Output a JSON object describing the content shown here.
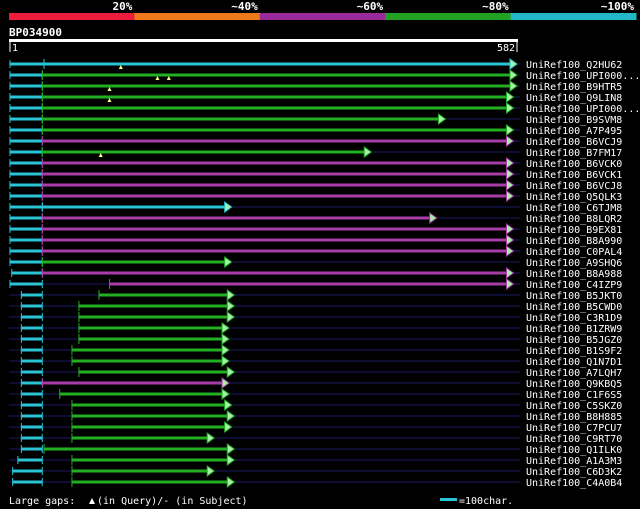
{
  "identity_scale": {
    "ticks": [
      "20%",
      "~40%",
      "~60%",
      "~80%",
      "~100%"
    ],
    "colors": [
      "#ee1c3c",
      "#ee7a1c",
      "#9a2a9a",
      "#22a022",
      "#22b8c8"
    ]
  },
  "query": {
    "id": "BP034900",
    "start_label": "1",
    "end_label": "582",
    "length": 582
  },
  "footer": {
    "gaps_prefix": "Large gaps: ",
    "gaps_query": "(in Query)/",
    "gaps_dash": "-",
    "gaps_subject": " (in Subject)",
    "scale_label": "=100char."
  },
  "colors": {
    "query_segment": "#29c5d6",
    "green": "#22b022",
    "purple": "#a83ca8",
    "arrow_fill": "#a8f0a8",
    "guide": "#1a1a66",
    "gap_marker": "#ffff88"
  },
  "chart_data": {
    "type": "alignment-overview",
    "query_length": 582,
    "hits": [
      {
        "name": "UniRef100_Q2HU62",
        "color": "cyan",
        "qs": 1,
        "qe": 40,
        "ss": 40,
        "se": 582,
        "gaps": []
      },
      {
        "name": "UniRef100_UPI000...",
        "color": "green",
        "qs": 1,
        "qe": 38,
        "ss": 38,
        "se": 582,
        "gaps": [
          128
        ]
      },
      {
        "name": "UniRef100_B9HTR5",
        "color": "green",
        "qs": 1,
        "qe": 38,
        "ss": 38,
        "se": 582,
        "gaps": [
          170,
          183
        ]
      },
      {
        "name": "UniRef100_Q9LIN8",
        "color": "green",
        "qs": 1,
        "qe": 38,
        "ss": 38,
        "se": 578,
        "gaps": [
          115
        ]
      },
      {
        "name": "UniRef100_UPI000...",
        "color": "green",
        "qs": 1,
        "qe": 38,
        "ss": 38,
        "se": 578,
        "gaps": [
          115
        ]
      },
      {
        "name": "UniRef100_B9SVM8",
        "color": "green",
        "qs": 1,
        "qe": 38,
        "ss": 38,
        "se": 500,
        "gaps": []
      },
      {
        "name": "UniRef100_A7P495",
        "color": "green",
        "qs": 1,
        "qe": 38,
        "ss": 38,
        "se": 578,
        "gaps": []
      },
      {
        "name": "UniRef100_B6VCJ9",
        "color": "purple",
        "qs": 1,
        "qe": 38,
        "ss": 38,
        "se": 578,
        "gaps": []
      },
      {
        "name": "UniRef100_B7FM17",
        "color": "green",
        "qs": 1,
        "qe": 38,
        "ss": 38,
        "se": 415,
        "gaps": []
      },
      {
        "name": "UniRef100_B6VCK0",
        "color": "purple",
        "qs": 1,
        "qe": 38,
        "ss": 38,
        "se": 578,
        "gaps": [
          105
        ]
      },
      {
        "name": "UniRef100_B6VCK1",
        "color": "purple",
        "qs": 1,
        "qe": 38,
        "ss": 38,
        "se": 578,
        "gaps": []
      },
      {
        "name": "UniRef100_B6VCJ8",
        "color": "purple",
        "qs": 1,
        "qe": 38,
        "ss": 38,
        "se": 578,
        "gaps": []
      },
      {
        "name": "UniRef100_Q5QLK3",
        "color": "purple",
        "qs": 1,
        "qe": 38,
        "ss": 38,
        "se": 578,
        "gaps": []
      },
      {
        "name": "UniRef100_C6TJM8",
        "color": "cyan",
        "qs": 1,
        "qe": 38,
        "ss": 38,
        "se": 255,
        "gaps": []
      },
      {
        "name": "UniRef100_B8LQR2",
        "color": "purple",
        "qs": 1,
        "qe": 38,
        "ss": 38,
        "se": 490,
        "gaps": []
      },
      {
        "name": "UniRef100_B9EX81",
        "color": "purple",
        "qs": 1,
        "qe": 38,
        "ss": 38,
        "se": 578,
        "gaps": []
      },
      {
        "name": "UniRef100_B8A990",
        "color": "purple",
        "qs": 1,
        "qe": 38,
        "ss": 38,
        "se": 578,
        "gaps": []
      },
      {
        "name": "UniRef100_C0PAL4",
        "color": "purple",
        "qs": 1,
        "qe": 38,
        "ss": 38,
        "se": 578,
        "gaps": []
      },
      {
        "name": "UniRef100_A9SHQ6",
        "color": "green",
        "qs": 1,
        "qe": 38,
        "ss": 38,
        "se": 255,
        "gaps": []
      },
      {
        "name": "UniRef100_B8A988",
        "color": "purple",
        "qs": 3,
        "qe": 38,
        "ss": 38,
        "se": 578,
        "gaps": []
      },
      {
        "name": "UniRef100_C4IZP9",
        "color": "purple",
        "qs": 1,
        "qe": 38,
        "ss": 115,
        "se": 578,
        "gaps": []
      },
      {
        "name": "UniRef100_B5JKT0",
        "color": "green",
        "qs": 14,
        "qe": 38,
        "ss": 103,
        "se": 258,
        "gaps": []
      },
      {
        "name": "UniRef100_B5CWD0",
        "color": "green",
        "qs": 14,
        "qe": 38,
        "ss": 80,
        "se": 258,
        "gaps": []
      },
      {
        "name": "UniRef100_C3R1D9",
        "color": "green",
        "qs": 14,
        "qe": 38,
        "ss": 80,
        "se": 258,
        "gaps": []
      },
      {
        "name": "UniRef100_B1ZRW9",
        "color": "green",
        "qs": 14,
        "qe": 38,
        "ss": 80,
        "se": 252,
        "gaps": []
      },
      {
        "name": "UniRef100_B5JGZ0",
        "color": "green",
        "qs": 14,
        "qe": 38,
        "ss": 80,
        "se": 252,
        "gaps": []
      },
      {
        "name": "UniRef100_B1S9F2",
        "color": "green",
        "qs": 14,
        "qe": 38,
        "ss": 72,
        "se": 252,
        "gaps": []
      },
      {
        "name": "UniRef100_Q1N7D1",
        "color": "green",
        "qs": 14,
        "qe": 38,
        "ss": 72,
        "se": 252,
        "gaps": []
      },
      {
        "name": "UniRef100_A7LQH7",
        "color": "green",
        "qs": 14,
        "qe": 38,
        "ss": 80,
        "se": 258,
        "gaps": []
      },
      {
        "name": "UniRef100_Q9KBQ5",
        "color": "purple",
        "qs": 14,
        "qe": 38,
        "ss": 38,
        "se": 252,
        "gaps": []
      },
      {
        "name": "UniRef100_C1F6S5",
        "color": "green",
        "qs": 14,
        "qe": 38,
        "ss": 58,
        "se": 252,
        "gaps": []
      },
      {
        "name": "UniRef100_C5SKZ0",
        "color": "green",
        "qs": 14,
        "qe": 38,
        "ss": 72,
        "se": 255,
        "gaps": []
      },
      {
        "name": "UniRef100_B8H885",
        "color": "green",
        "qs": 14,
        "qe": 38,
        "ss": 72,
        "se": 258,
        "gaps": []
      },
      {
        "name": "UniRef100_C7PCU7",
        "color": "green",
        "qs": 14,
        "qe": 38,
        "ss": 72,
        "se": 255,
        "gaps": []
      },
      {
        "name": "UniRef100_C9RT70",
        "color": "green",
        "qs": 14,
        "qe": 38,
        "ss": 72,
        "se": 235,
        "gaps": []
      },
      {
        "name": "UniRef100_Q1ILK0",
        "color": "green",
        "qs": 14,
        "qe": 38,
        "ss": 40,
        "se": 258,
        "gaps": []
      },
      {
        "name": "UniRef100_A1A3M3",
        "color": "green",
        "qs": 10,
        "qe": 38,
        "ss": 72,
        "se": 258,
        "gaps": []
      },
      {
        "name": "UniRef100_C6D3K2",
        "color": "green",
        "qs": 4,
        "qe": 38,
        "ss": 72,
        "se": 235,
        "gaps": []
      },
      {
        "name": "UniRef100_C4A0B4",
        "color": "green",
        "qs": 4,
        "qe": 38,
        "ss": 72,
        "se": 258,
        "gaps": []
      }
    ]
  }
}
